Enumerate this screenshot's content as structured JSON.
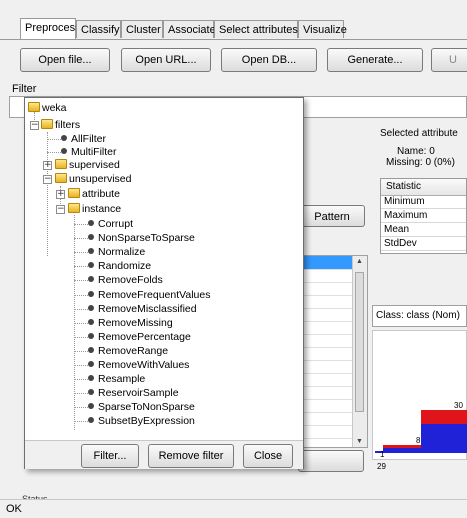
{
  "tabs": [
    "Preprocess",
    "Classify",
    "Cluster",
    "Associate",
    "Select attributes",
    "Visualize"
  ],
  "active_tab": "Preprocess",
  "toolbar": {
    "open_file": "Open file...",
    "open_url": "Open URL...",
    "open_db": "Open DB...",
    "generate": "Generate...",
    "undo_partial": "U"
  },
  "filter_label": "Filter",
  "selected_attribute": {
    "title": "Selected attribute",
    "name": "Name: 0",
    "missing": "Missing: 0 (0%)"
  },
  "stats": {
    "header": "Statistic",
    "rows": [
      "Minimum",
      "Maximum",
      "Mean",
      "StdDev"
    ]
  },
  "pattern_button": "Pattern",
  "class_select": "Class: class (Nom)",
  "histogram": {
    "labels": [
      "30",
      "8",
      "1",
      "29"
    ],
    "blue": "#1f22d6",
    "red": "#e0151a"
  },
  "status": {
    "label": "Status",
    "text": "OK"
  },
  "tree": {
    "root": "weka",
    "filters": "filters",
    "all_filter": "AllFilter",
    "multi_filter": "MultiFilter",
    "supervised": "supervised",
    "unsupervised": "unsupervised",
    "attribute": "attribute",
    "instance": "instance",
    "instance_items": [
      "Corrupt",
      "NonSparseToSparse",
      "Normalize",
      "Randomize",
      "RemoveFolds",
      "RemoveFrequentValues",
      "RemoveMisclassified",
      "RemoveMissing",
      "RemovePercentage",
      "RemoveRange",
      "RemoveWithValues",
      "Resample",
      "ReservoirSample",
      "SparseToNonSparse",
      "SubsetByExpression"
    ]
  },
  "popup_buttons": {
    "filter": "Filter...",
    "remove_filter": "Remove filter",
    "close": "Close"
  }
}
